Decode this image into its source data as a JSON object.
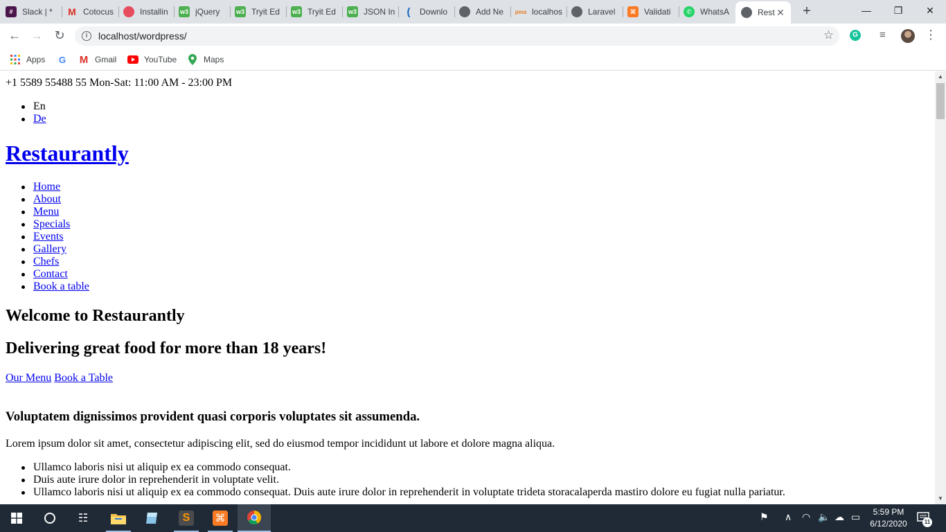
{
  "browser": {
    "tabs": [
      {
        "title": "Slack | *",
        "icon": "slack-icon",
        "color": "#4a154b"
      },
      {
        "title": "Cotocus",
        "icon": "gmail-icon",
        "color": "#d93025"
      },
      {
        "title": "Installin",
        "icon": "laracasts-icon",
        "color": "#e74c5e"
      },
      {
        "title": "jQuery",
        "icon": "w3schools-icon",
        "color": "#4caf50"
      },
      {
        "title": "Tryit Ed",
        "icon": "w3schools-icon",
        "color": "#4caf50"
      },
      {
        "title": "Tryit Ed",
        "icon": "w3schools-icon",
        "color": "#4caf50"
      },
      {
        "title": "JSON In",
        "icon": "w3schools-icon",
        "color": "#4caf50"
      },
      {
        "title": "Downlo",
        "icon": "wave-icon",
        "color": "#1565c0"
      },
      {
        "title": "Add Ne",
        "icon": "globe-icon",
        "color": "#5f6368"
      },
      {
        "title": "localhos",
        "icon": "phpmyadmin-icon",
        "color": "#e67e22"
      },
      {
        "title": "Laravel",
        "icon": "globe-icon",
        "color": "#5f6368"
      },
      {
        "title": "Validati",
        "icon": "xampp-icon",
        "color": "#fb7a24"
      },
      {
        "title": "WhatsA",
        "icon": "whatsapp-icon",
        "color": "#25d366"
      },
      {
        "title": "Rest",
        "icon": "globe-icon",
        "color": "#5f6368"
      }
    ],
    "url": "localhost/wordpress/",
    "bookmarks": [
      {
        "label": "Apps",
        "icon": "apps-grid-icon"
      },
      {
        "label": "",
        "icon": "google-icon"
      },
      {
        "label": "Gmail",
        "icon": "gmail-icon"
      },
      {
        "label": "YouTube",
        "icon": "youtube-icon"
      },
      {
        "label": "Maps",
        "icon": "maps-icon"
      }
    ]
  },
  "page": {
    "topbar_contact": "+1 5589 55488 55 Mon-Sat: 11:00 AM - 23:00 PM",
    "languages": [
      "En",
      "De"
    ],
    "site_title": "Restaurantly",
    "nav": [
      "Home",
      "About",
      "Menu",
      "Specials",
      "Events",
      "Gallery",
      "Chefs",
      "Contact",
      "Book a table"
    ],
    "hero_title": "Welcome to Restaurantly",
    "hero_subtitle": "Delivering great food for more than 18 years!",
    "hero_links": [
      "Our Menu",
      "Book a Table"
    ],
    "about_heading": "Voluptatem dignissimos provident quasi corporis voluptates sit assumenda.",
    "about_text": "Lorem ipsum dolor sit amet, consectetur adipiscing elit, sed do eiusmod tempor incididunt ut labore et dolore magna aliqua.",
    "about_list": [
      "Ullamco laboris nisi ut aliquip ex ea commodo consequat.",
      "Duis aute irure dolor in reprehenderit in voluptate velit.",
      "Ullamco laboris nisi ut aliquip ex ea commodo consequat. Duis aute irure dolor in reprehenderit in voluptate trideta storacalaperda mastiro dolore eu fugiat nulla pariatur."
    ]
  },
  "taskbar": {
    "time": "5:59 PM",
    "date": "6/12/2020",
    "notification_count": "11"
  }
}
